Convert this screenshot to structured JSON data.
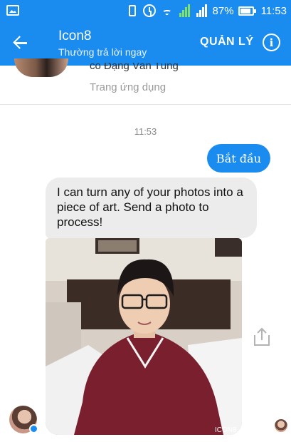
{
  "status_bar": {
    "battery_percent": "87%",
    "time": "11:53"
  },
  "header": {
    "title": "Icon8",
    "subtitle": "Thường trả lời ngay",
    "manage_label": "QUẢN LÝ",
    "info_glyph": "i"
  },
  "profile": {
    "name_partial": "có Đặng Văn Tùng",
    "type": "Trang ứng dụng"
  },
  "chat": {
    "timestamp": "11:53",
    "outgoing_message": "Bắt đầu",
    "incoming_message": "I can turn any of your photos into a piece of art. Send a photo to process!",
    "photo_watermark": "ICON8"
  },
  "colors": {
    "brand_blue": "#1a8cf0",
    "incoming_bubble": "#ececec"
  }
}
